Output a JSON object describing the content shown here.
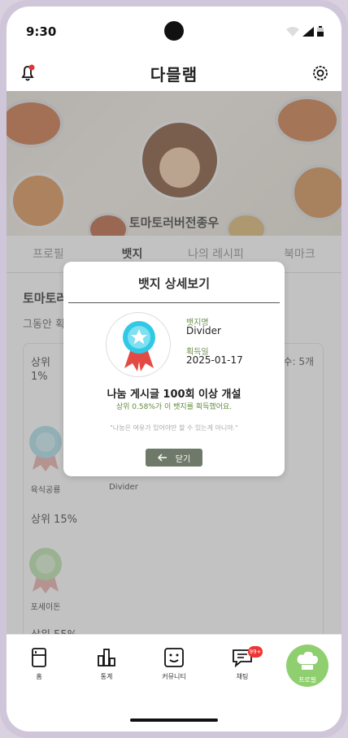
{
  "status": {
    "time": "9:30"
  },
  "header": {
    "logo_text": "다믈램"
  },
  "profile": {
    "nickname": "토마토러버전종우",
    "tabs": [
      {
        "label": "프로필"
      },
      {
        "label": "뱃지"
      },
      {
        "label": "나의 레시피"
      },
      {
        "label": "북마크"
      }
    ]
  },
  "badges_page": {
    "section_title": "토마토러",
    "section_sub": "그동안 획",
    "count_text": "수: 5개",
    "ranks": [
      "상위\n1%",
      "상위 15%",
      "상위 55%"
    ],
    "badge_labels": [
      "육식공룡",
      "Divider",
      "포세이돈"
    ]
  },
  "modal": {
    "title": "뱃지 상세보기",
    "badge_name_label": "뱃지명",
    "badge_name": "Divider",
    "acquired_label": "획득일",
    "acquired_date": "2025-01-17",
    "heading": "나눔 게시글 100회 이상 개설",
    "percent_text": "상위 0.58%가 이 뱃지를 획득했어요.",
    "quote": "\"나눔은 여유가 있어야만 할 수 있는게 아니야.\"",
    "close_label": "닫기"
  },
  "bottom_nav": {
    "items": [
      {
        "label": "홈"
      },
      {
        "label": "통계"
      },
      {
        "label": "커뮤니티"
      },
      {
        "label": "채팅"
      },
      {
        "label": "프로필"
      }
    ],
    "chat_badge": "99+"
  },
  "colors": {
    "accent_green": "#8fcf6f",
    "close_button": "#6f7969",
    "notification_dot": "#e33333"
  }
}
